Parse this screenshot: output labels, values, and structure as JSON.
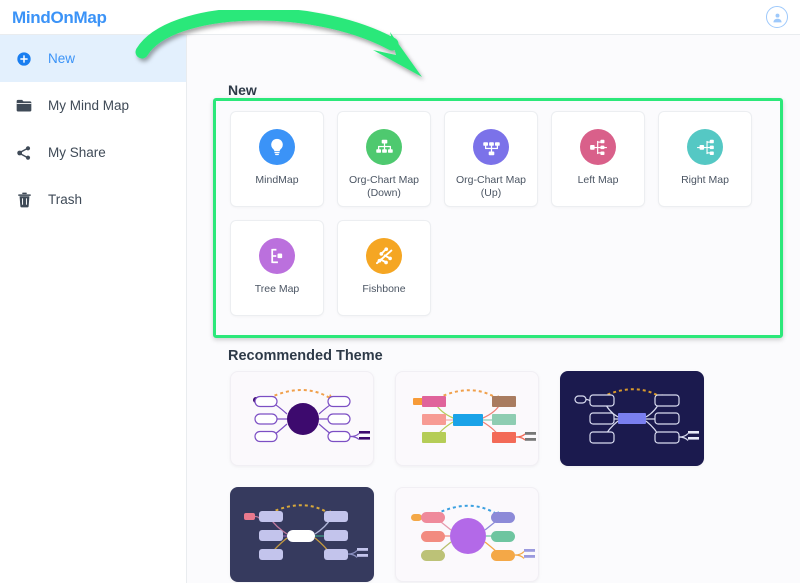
{
  "header": {
    "logo_text": "MindOnMap",
    "logo_color": "#3b93f7",
    "avatar_icon": "user-circle-icon"
  },
  "sidebar": {
    "items": [
      {
        "id": "new",
        "label": "New",
        "icon": "plus-circle-icon",
        "active": true
      },
      {
        "id": "my-mind-map",
        "label": "My Mind Map",
        "icon": "folder-icon",
        "active": false
      },
      {
        "id": "my-share",
        "label": "My Share",
        "icon": "share-nodes-icon",
        "active": false
      },
      {
        "id": "trash",
        "label": "Trash",
        "icon": "trash-icon",
        "active": false
      }
    ]
  },
  "main": {
    "new_section_title": "New",
    "theme_section_title": "Recommended Theme",
    "templates": [
      {
        "label": "MindMap",
        "icon": "lightbulb-icon",
        "color": "#3b93f7"
      },
      {
        "label": "Org-Chart Map (Down)",
        "icon": "org-chart-down-icon",
        "color": "#4ec96f"
      },
      {
        "label": "Org-Chart Map (Up)",
        "icon": "org-chart-up-icon",
        "color": "#7b72e9"
      },
      {
        "label": "Left Map",
        "icon": "left-map-icon",
        "color": "#d9608a"
      },
      {
        "label": "Right Map",
        "icon": "right-map-icon",
        "color": "#55c8c4"
      },
      {
        "label": "Tree Map",
        "icon": "tree-map-icon",
        "color": "#b濃"
      },
      {
        "label": "Fishbone",
        "icon": "fishbone-icon",
        "color": "#f5a623"
      }
    ],
    "template_colors": [
      "#3b93f7",
      "#4ec96f",
      "#7b72e9",
      "#d9608a",
      "#55c8c4",
      "#bb70dd",
      "#f5a623"
    ],
    "themes": [
      {
        "id": "theme-1",
        "style": "light",
        "center_color": "#3d0a6e",
        "accent": "#f0a04b",
        "name": "purple-radial-theme"
      },
      {
        "id": "theme-2",
        "style": "light",
        "center_color": "#1aa3e8",
        "accent": "#f0a04b",
        "name": "colorful-blocks-theme"
      },
      {
        "id": "theme-3",
        "style": "dark1",
        "center_color": "#7a7ff0",
        "accent": "#d99a2b",
        "name": "navy-dark-theme"
      },
      {
        "id": "theme-4",
        "style": "dark2",
        "center_color": "#ffffff",
        "accent": "#d9a93b",
        "name": "slate-dark-theme"
      },
      {
        "id": "theme-5",
        "style": "light",
        "center_color": "#b369e8",
        "accent": "#3aa0e0",
        "name": "pastel-radial-theme"
      }
    ]
  },
  "annotation": {
    "highlight_color": "#2ce87a",
    "arrow_color": "#2ce87a",
    "arrow_name": "green-curved-arrow"
  }
}
